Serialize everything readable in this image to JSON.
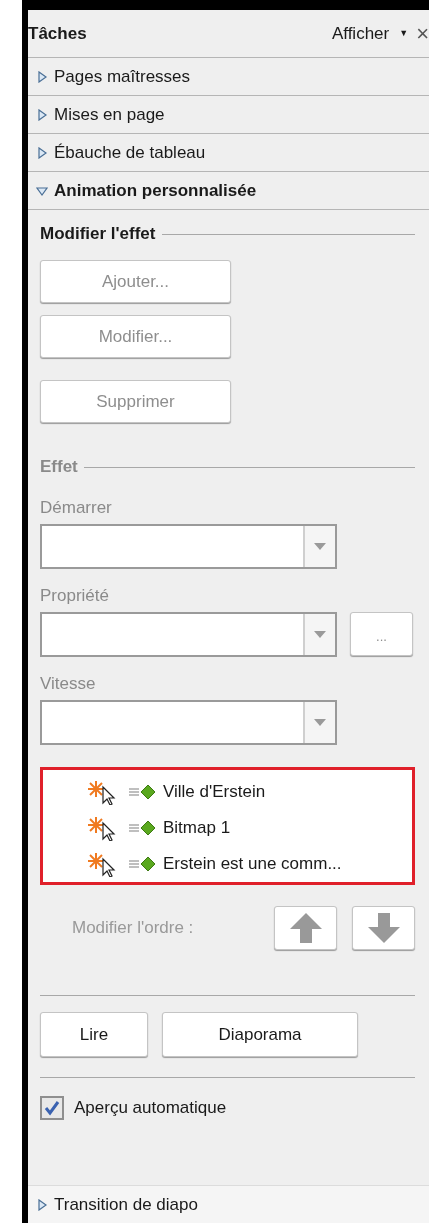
{
  "header": {
    "title": "Tâches",
    "menu_label": "Afficher",
    "menu_arrow": "▼",
    "close": "×"
  },
  "sections_before": [
    {
      "label": "Pages maîtresses",
      "expanded": false
    },
    {
      "label": "Mises en page",
      "expanded": false
    },
    {
      "label": "Ébauche de tableau",
      "expanded": false
    },
    {
      "label": "Animation personnalisée",
      "expanded": true
    }
  ],
  "modify_effect": {
    "title": "Modifier l'effet",
    "buttons": [
      {
        "label": "Ajouter...",
        "disabled": true
      },
      {
        "label": "Modifier...",
        "disabled": true
      },
      {
        "label": "Supprimer",
        "disabled": true
      }
    ]
  },
  "effect": {
    "title": "Effet",
    "disabled": true,
    "fields": [
      {
        "label": "Démarrer",
        "extra_button": false
      },
      {
        "label": "Propriété",
        "extra_button": true,
        "extra_label": "..."
      },
      {
        "label": "Vitesse",
        "extra_button": false
      }
    ]
  },
  "animation_list": [
    {
      "label": "Ville d'Erstein"
    },
    {
      "label": "Bitmap 1"
    },
    {
      "label": "Erstein est une comm..."
    }
  ],
  "order": {
    "label": "Modifier l'ordre :",
    "disabled": true
  },
  "play_buttons": [
    {
      "label": "Lire"
    },
    {
      "label": "Diaporama"
    }
  ],
  "auto_preview": {
    "label": "Aperçu automatique",
    "checked": true
  },
  "sections_after": [
    {
      "label": "Transition de diapo",
      "expanded": false
    }
  ]
}
